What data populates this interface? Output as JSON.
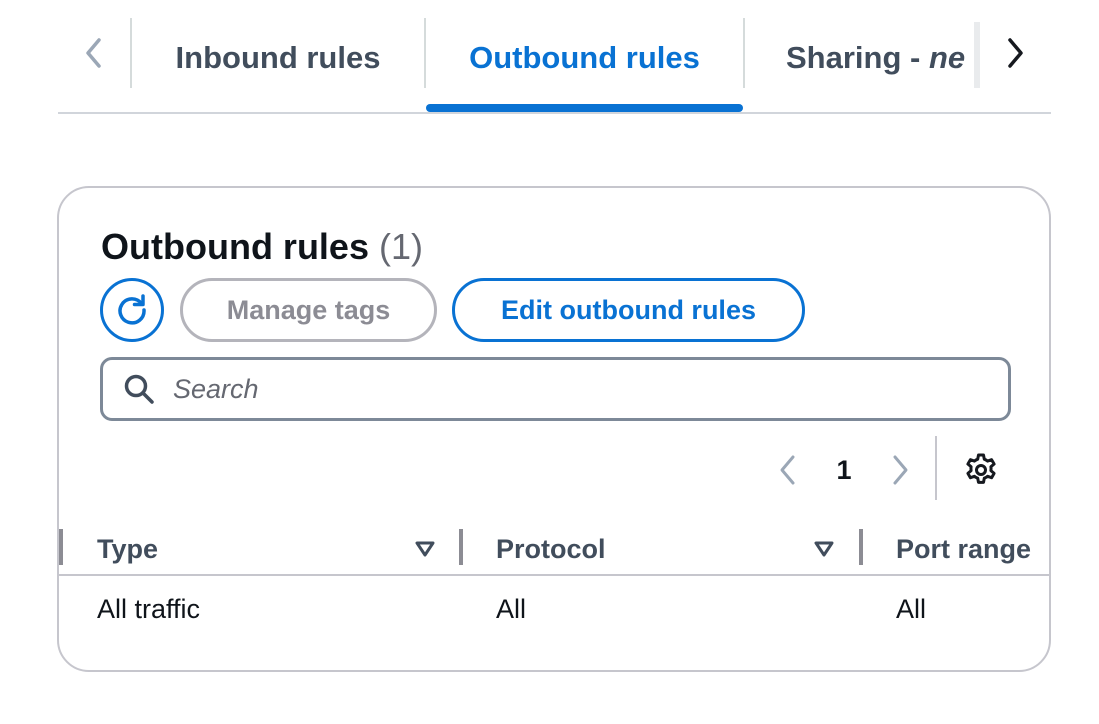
{
  "tabs": {
    "items": [
      {
        "label": "Inbound rules"
      },
      {
        "label": "Outbound rules"
      },
      {
        "label_prefix": "Sharing - ",
        "label_italic": "ne"
      }
    ],
    "active_index": 1,
    "prev_icon": "chevron-left-icon",
    "next_icon": "chevron-right-icon"
  },
  "panel": {
    "title": "Outbound rules",
    "count": "(1)",
    "refresh_icon": "refresh-icon",
    "manage_tags_label": "Manage tags",
    "edit_label": "Edit outbound rules",
    "search_placeholder": "Search",
    "search_icon": "search-icon"
  },
  "pagination": {
    "current_page": "1",
    "prev_icon": "chevron-left-icon",
    "next_icon": "chevron-right-icon",
    "settings_icon": "gear-icon"
  },
  "table": {
    "columns": [
      {
        "label": "Type",
        "sortable": true
      },
      {
        "label": "Protocol",
        "sortable": true
      },
      {
        "label": "Port range",
        "sortable": false
      }
    ],
    "rows": [
      [
        "All traffic",
        "All",
        "All"
      ]
    ]
  },
  "colors": {
    "accent": "#0972d3",
    "text": "#0f141a",
    "muted": "#656871",
    "border": "#c6c6cd"
  }
}
